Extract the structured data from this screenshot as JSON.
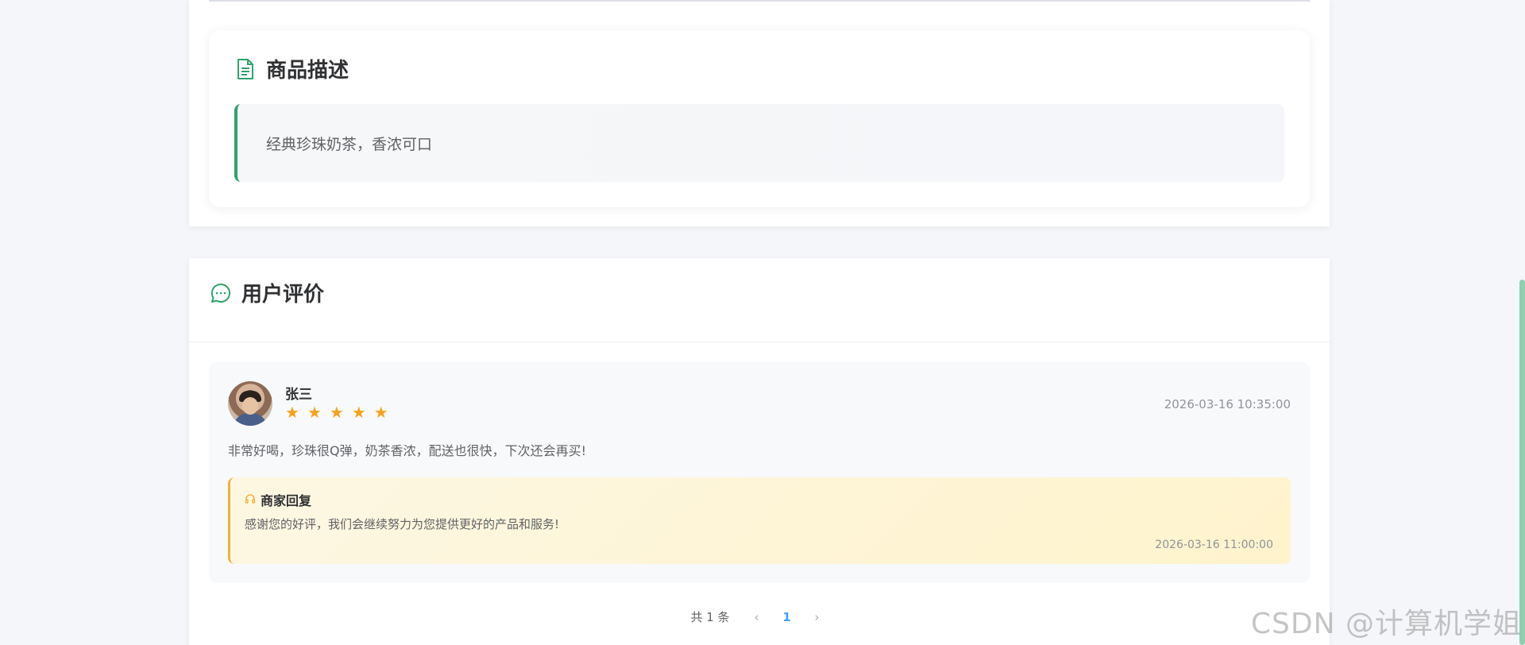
{
  "description_section": {
    "title": "商品描述",
    "text": "经典珍珠奶茶，香浓可口"
  },
  "review_section": {
    "title": "用户评价",
    "reviews": [
      {
        "username": "张三",
        "rating": 5,
        "stars": "★ ★ ★ ★ ★",
        "time": "2026-03-16 10:35:00",
        "content": "非常好喝，珍珠很Q弹，奶茶香浓，配送也很快，下次还会再买!",
        "reply": {
          "title": "商家回复",
          "content": "感谢您的好评，我们会继续努力为您提供更好的产品和服务!",
          "time": "2026-03-16 11:00:00"
        }
      }
    ]
  },
  "pagination": {
    "total_text": "共 1 条",
    "current_page": "1",
    "prev_icon": "‹",
    "next_icon": "›"
  },
  "watermark": "CSDN @计算机学姐",
  "colors": {
    "accent_green": "#2fa36b",
    "star": "#f7a21b",
    "reply_border": "#f0b43a",
    "page_active": "#409eff"
  }
}
